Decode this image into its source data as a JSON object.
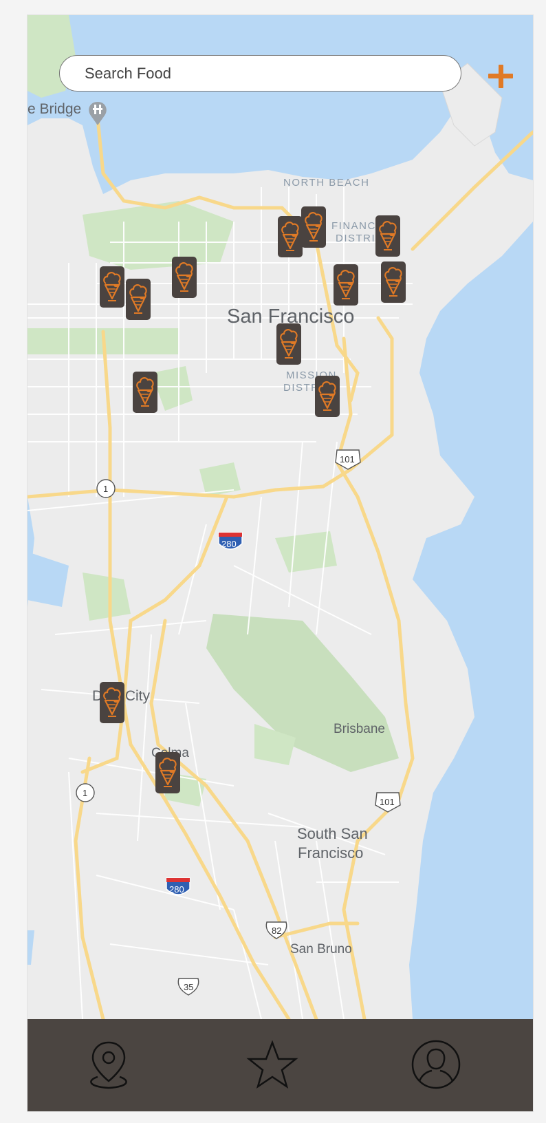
{
  "search": {
    "placeholder": "Search Food",
    "value": ""
  },
  "add_button": {
    "icon": "plus-icon",
    "color": "#e07a26"
  },
  "map": {
    "labels": {
      "bridge": "e Bridge",
      "north_beach": "NORTH BEACH",
      "financial_1": "FINANCIAL",
      "financial_2": "DISTRICT",
      "san_francisco": "San Francisco",
      "mission_1": "MISSION",
      "mission_2": "DISTRICT",
      "daly_city": "Daly City",
      "colma": "Colma",
      "brisbane": "Brisbane",
      "south_sf_1": "South San",
      "south_sf_2": "Francisco",
      "san_bruno": "San Bruno"
    },
    "shields": {
      "us101_a": "101",
      "us101_b": "101",
      "ca1_a": "1",
      "ca1_b": "1",
      "i280_a": "280",
      "i280_b": "280",
      "ca82": "82",
      "ca35": "35"
    },
    "pin_icon": "ice-cream-icon",
    "pin_count": 14,
    "colors": {
      "water": "#b8d8f5",
      "land": "#ececec",
      "park": "#cfe6c4",
      "highway": "#f8d88a",
      "pin": "#4a4340",
      "pin_icon": "#e07a26"
    }
  },
  "tabbar": {
    "background": "#4b4541",
    "items": [
      {
        "name": "map",
        "icon": "location-pin-icon"
      },
      {
        "name": "favorites",
        "icon": "star-icon"
      },
      {
        "name": "profile",
        "icon": "user-icon"
      }
    ]
  }
}
